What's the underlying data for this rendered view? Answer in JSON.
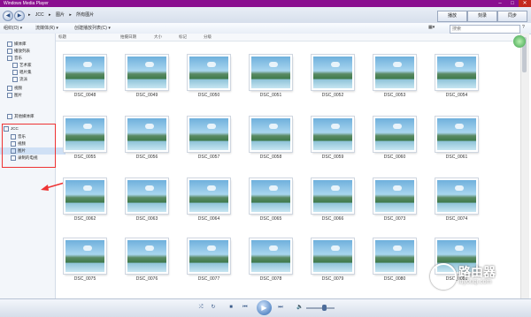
{
  "window": {
    "title": "Windows Media Player",
    "controls": [
      "–",
      "□",
      "✕"
    ]
  },
  "address": {
    "back": "◀",
    "forward": "▶",
    "crumbs": [
      "▸",
      "JCC",
      "▸",
      "图片",
      "▸",
      "所有图片"
    ],
    "buttons": [
      "播放",
      "刻录",
      "同步"
    ]
  },
  "toolbar": {
    "organize": "组织(O) ▾",
    "stream": "流媒体(R) ▾",
    "create_playlist": "创建播放列表(C) ▾",
    "view_icon": "▦▾",
    "search_placeholder": "搜索",
    "help": "?"
  },
  "columns": [
    "标题",
    "拍摄日期",
    "大小",
    "标记",
    "分级"
  ],
  "sidebar": {
    "items": [
      {
        "label": "媒体库",
        "icon": "library-icon"
      },
      {
        "label": "播放列表",
        "icon": "playlist-icon"
      },
      {
        "label": "音乐",
        "icon": "music-icon"
      },
      {
        "label": "艺术家",
        "icon": "artist-icon"
      },
      {
        "label": "唱片集",
        "icon": "album-icon"
      },
      {
        "label": "流派",
        "icon": "genre-icon"
      },
      {
        "label": "视频",
        "icon": "video-icon"
      },
      {
        "label": "图片",
        "icon": "picture-icon"
      },
      {
        "label": "其他媒体库",
        "icon": "other-library-icon"
      },
      {
        "label": "JCC",
        "icon": "user-icon"
      },
      {
        "label": "音乐",
        "icon": "music-icon"
      },
      {
        "label": "视频",
        "icon": "video-icon"
      },
      {
        "label": "图片",
        "icon": "picture-icon"
      },
      {
        "label": "录制的电视",
        "icon": "tv-icon"
      }
    ]
  },
  "photos": [
    "DSC_0048",
    "DSC_0049",
    "DSC_0050",
    "DSC_0051",
    "DSC_0052",
    "DSC_0053",
    "DSC_0054",
    "DSC_0055",
    "DSC_0056",
    "DSC_0057",
    "DSC_0058",
    "DSC_0059",
    "DSC_0060",
    "DSC_0061",
    "DSC_0062",
    "DSC_0063",
    "DSC_0064",
    "DSC_0065",
    "DSC_0066",
    "DSC_0073",
    "DSC_0074",
    "DSC_0075",
    "DSC_0076",
    "DSC_0077",
    "DSC_0078",
    "DSC_0079",
    "DSC_0080",
    "DSC_0081"
  ],
  "player": {
    "shuffle": "⤮",
    "repeat": "↻",
    "stop": "■",
    "prev": "⏮",
    "play": "▶",
    "next": "⏭",
    "mute": "🔈"
  },
  "watermark": {
    "title": "路由器",
    "url": "luyouqi.com"
  },
  "colors": {
    "title_bar": "#8a0f8f",
    "highlight_box": "#ee3333",
    "selection": "#cfe0f5"
  }
}
